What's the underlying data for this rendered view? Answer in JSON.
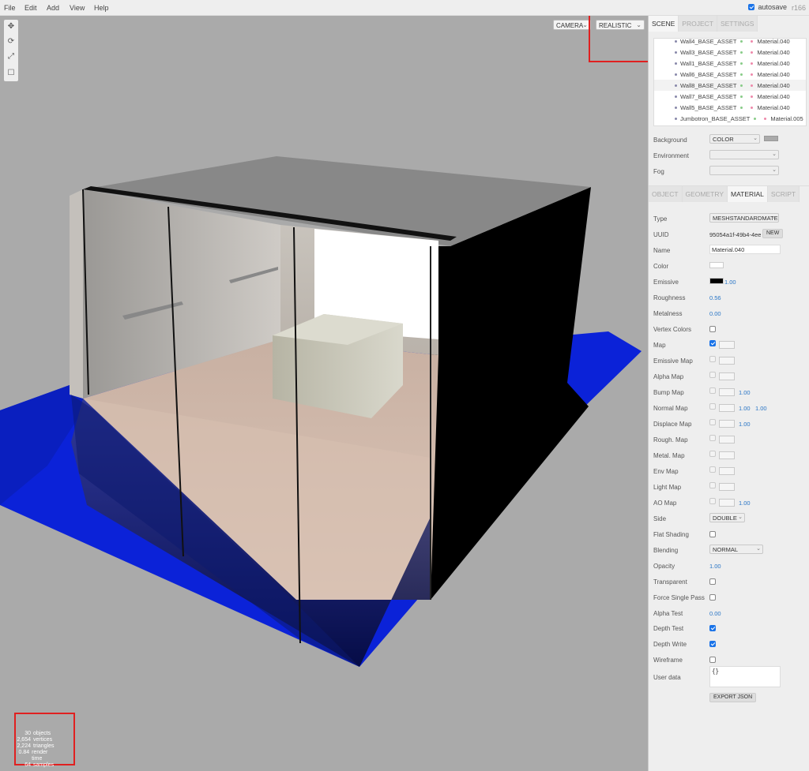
{
  "menubar": {
    "items": [
      "File",
      "Edit",
      "Add",
      "View",
      "Help"
    ],
    "autosave_label": "autosave",
    "revision": "r166"
  },
  "viewport": {
    "camera_select": "CAMERA",
    "shading_select": "REALISTIC",
    "info": {
      "objects": {
        "value": "30",
        "label": "objects"
      },
      "vertices": {
        "value": "2,654",
        "label": "vertices"
      },
      "triangles": {
        "value": "2,224",
        "label": "triangles"
      },
      "render_time": {
        "value": "0.84",
        "label": "render time"
      },
      "samples": {
        "value": "64",
        "label": "samples"
      }
    }
  },
  "sidebar": {
    "top_tabs": [
      "SCENE",
      "PROJECT",
      "SETTINGS"
    ],
    "outliner": [
      {
        "name": "Wall4_BASE_ASSET",
        "material": "Material.040"
      },
      {
        "name": "Wall3_BASE_ASSET",
        "material": "Material.040"
      },
      {
        "name": "Wall1_BASE_ASSET",
        "material": "Material.040"
      },
      {
        "name": "Wall6_BASE_ASSET",
        "material": "Material.040"
      },
      {
        "name": "Wall8_BASE_ASSET",
        "material": "Material.040"
      },
      {
        "name": "Wall7_BASE_ASSET",
        "material": "Material.040"
      },
      {
        "name": "Wall5_BASE_ASSET",
        "material": "Material.040"
      },
      {
        "name": "Jumbotron_BASE_ASSET",
        "material": "Material.005"
      }
    ],
    "scene": {
      "background_label": "Background",
      "background_value": "COLOR",
      "environment_label": "Environment",
      "fog_label": "Fog"
    },
    "prop_tabs": [
      "OBJECT",
      "GEOMETRY",
      "MATERIAL",
      "SCRIPT"
    ],
    "material": {
      "type_label": "Type",
      "type_value": "MESHSTANDARDMATE",
      "uuid_label": "UUID",
      "uuid_value": "95054a1f-49b4-4ee",
      "new_label": "NEW",
      "name_label": "Name",
      "name_value": "Material.040",
      "color_label": "Color",
      "emissive_label": "Emissive",
      "emissive_value": "1.00",
      "roughness_label": "Roughness",
      "roughness_value": "0.56",
      "metalness_label": "Metalness",
      "metalness_value": "0.00",
      "vertex_colors_label": "Vertex Colors",
      "map_label": "Map",
      "emissive_map_label": "Emissive Map",
      "alpha_map_label": "Alpha Map",
      "bump_map_label": "Bump Map",
      "bump_value": "1.00",
      "normal_map_label": "Normal Map",
      "normal_x": "1.00",
      "normal_y": "1.00",
      "displace_map_label": "Displace Map",
      "displace_value": "1.00",
      "rough_map_label": "Rough. Map",
      "metal_map_label": "Metal. Map",
      "env_map_label": "Env Map",
      "light_map_label": "Light Map",
      "ao_map_label": "AO Map",
      "ao_value": "1.00",
      "side_label": "Side",
      "side_value": "DOUBLE",
      "flat_shading_label": "Flat Shading",
      "blending_label": "Blending",
      "blending_value": "NORMAL",
      "opacity_label": "Opacity",
      "opacity_value": "1.00",
      "transparent_label": "Transparent",
      "force_single_pass_label": "Force Single Pass",
      "alpha_test_label": "Alpha Test",
      "alpha_test_value": "0.00",
      "depth_test_label": "Depth Test",
      "depth_write_label": "Depth Write",
      "wireframe_label": "Wireframe",
      "user_data_label": "User data",
      "user_data_value": "{}",
      "export_label": "EXPORT JSON"
    },
    "colors": {
      "material_color": "#ffffff",
      "emissive_color": "#000000",
      "background_color": "#aaaaaa"
    }
  }
}
